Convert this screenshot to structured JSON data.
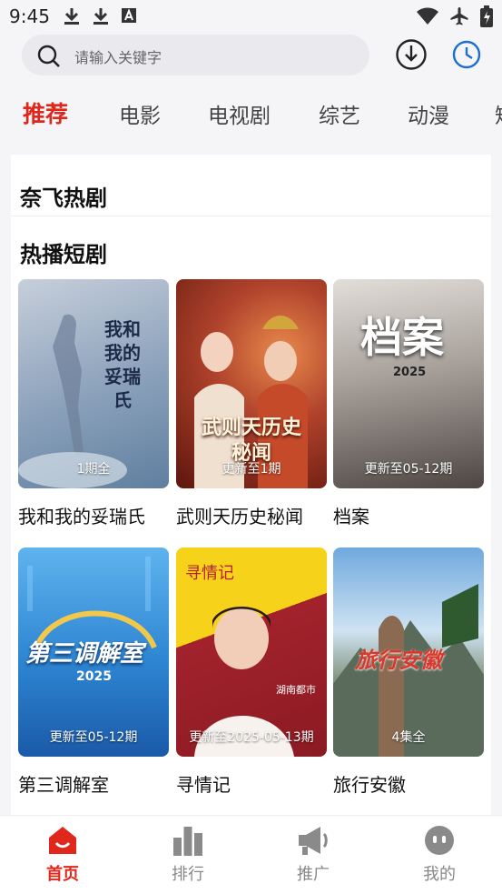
{
  "status_bar": {
    "time": "9:45"
  },
  "search": {
    "placeholder": "请输入关键字"
  },
  "tabs": [
    {
      "label": "推荐",
      "active": true
    },
    {
      "label": "电影",
      "active": false
    },
    {
      "label": "电视剧",
      "active": false
    },
    {
      "label": "综艺",
      "active": false
    },
    {
      "label": "动漫",
      "active": false
    },
    {
      "label": "短",
      "active": false
    }
  ],
  "sections": {
    "netflix": {
      "title": "奈飞热剧"
    },
    "short_drama": {
      "title": "热播短剧"
    }
  },
  "cards": [
    {
      "title": "我和我的妥瑞氏",
      "badge": "1期全",
      "poster_text": "我和我的妥瑞氏",
      "colors": [
        "#aab6c8",
        "#6e88a6"
      ]
    },
    {
      "title": "武则天历史秘闻",
      "badge": "更新至1期",
      "poster_text": "武则天历史秘闻",
      "colors": [
        "#b0432c",
        "#6b1a10"
      ]
    },
    {
      "title": "档案",
      "badge": "更新至05-12期",
      "poster_text": "档案",
      "sub_text": "2025",
      "colors": [
        "#d8d4d0",
        "#5a5350"
      ]
    },
    {
      "title": "第三调解室",
      "badge": "更新至05-12期",
      "poster_text": "第三调解室",
      "sub_text": "2025",
      "colors": [
        "#4aa2e6",
        "#1767b8"
      ]
    },
    {
      "title": "寻情记",
      "badge": "更新至2025-05-13期",
      "poster_text": "寻情记",
      "channel": "湖南都市",
      "colors": [
        "#f4c418",
        "#a2222c"
      ]
    },
    {
      "title": "旅行安徽",
      "badge": "4集全",
      "poster_text": "旅行安徽",
      "colors": [
        "#6fa9dd",
        "#3a6a48"
      ]
    }
  ],
  "bottom_nav": [
    {
      "label": "首页",
      "icon": "home-icon",
      "active": true
    },
    {
      "label": "排行",
      "icon": "ranking-icon",
      "active": false
    },
    {
      "label": "推广",
      "icon": "megaphone-icon",
      "active": false
    },
    {
      "label": "我的",
      "icon": "profile-icon",
      "active": false
    }
  ],
  "colors": {
    "accent": "#e0271b",
    "inactive": "#8a8a8a"
  }
}
